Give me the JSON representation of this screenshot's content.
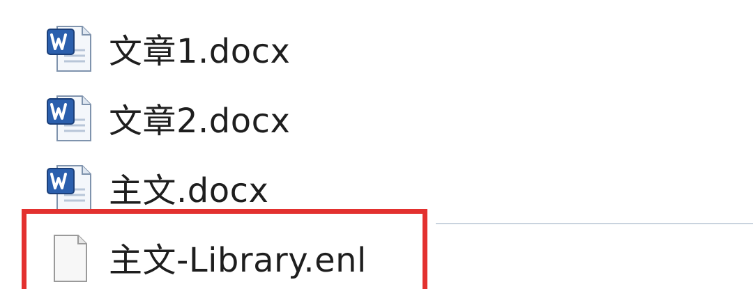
{
  "files": [
    {
      "name": "文章1.docx",
      "icon": "word-document-icon"
    },
    {
      "name": "文章2.docx",
      "icon": "word-document-icon"
    },
    {
      "name": "主文.docx",
      "icon": "word-document-icon"
    },
    {
      "name": "主文-Library.enl",
      "icon": "blank-file-icon"
    }
  ],
  "colors": {
    "highlight": "#e3312f",
    "word_blue": "#2b5fad",
    "divider": "#c9d3de"
  }
}
